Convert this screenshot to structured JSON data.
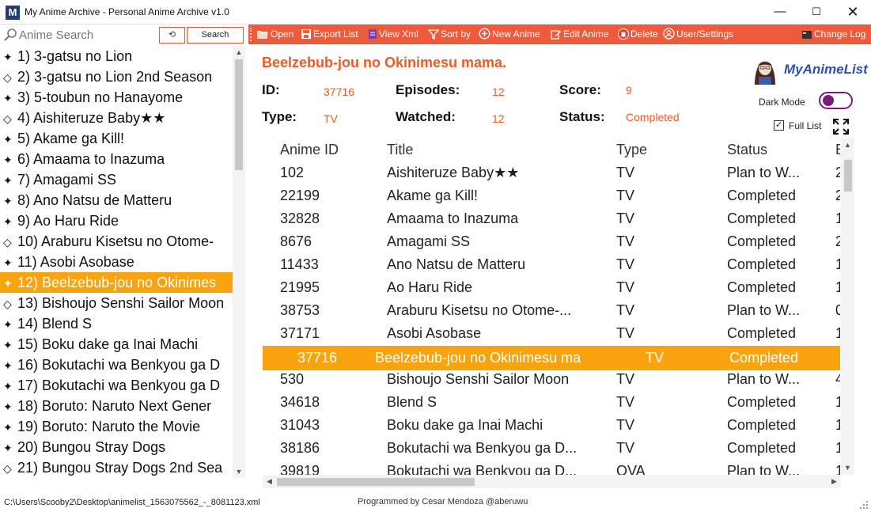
{
  "window": {
    "title": "My Anime Archive - Personal Anime Archive v1.0",
    "app_icon_letter": "M"
  },
  "search": {
    "placeholder": "Anime Search",
    "reset_label": "⟲",
    "button_label": "Search"
  },
  "anime_list": [
    {
      "bullet": "✦",
      "label": "1) 3-gatsu no Lion"
    },
    {
      "bullet": "◇",
      "label": "2) 3-gatsu no Lion 2nd Season"
    },
    {
      "bullet": "✦",
      "label": "3) 5-toubun no Hanayome"
    },
    {
      "bullet": "◇",
      "label": "4) Aishiteruze Baby★★"
    },
    {
      "bullet": "✦",
      "label": "5) Akame ga Kill!"
    },
    {
      "bullet": "✦",
      "label": "6) Amaama to Inazuma"
    },
    {
      "bullet": "✦",
      "label": "7) Amagami SS"
    },
    {
      "bullet": "✦",
      "label": "8) Ano Natsu de Matteru"
    },
    {
      "bullet": "✦",
      "label": "9) Ao Haru Ride"
    },
    {
      "bullet": "◇",
      "label": "10) Araburu Kisetsu no Otome-"
    },
    {
      "bullet": "✦",
      "label": "11) Asobi Asobase"
    },
    {
      "bullet": "✦",
      "label": "12) Beelzebub-jou no Okinimes",
      "selected": true
    },
    {
      "bullet": "◇",
      "label": "13) Bishoujo Senshi Sailor Moon"
    },
    {
      "bullet": "✦",
      "label": "14) Blend S"
    },
    {
      "bullet": "✦",
      "label": "15) Boku dake ga Inai Machi"
    },
    {
      "bullet": "✦",
      "label": "16) Bokutachi wa Benkyou ga D"
    },
    {
      "bullet": "✦",
      "label": "17) Bokutachi wa Benkyou ga D"
    },
    {
      "bullet": "✦",
      "label": "18) Boruto: Naruto Next Gener"
    },
    {
      "bullet": "✦",
      "label": "19) Boruto: Naruto the Movie"
    },
    {
      "bullet": "✦",
      "label": "20) Bungou Stray Dogs"
    },
    {
      "bullet": "◇",
      "label": "21) Bungou Stray Dogs 2nd Sea"
    }
  ],
  "toolbar": {
    "open": "Open",
    "export": "Export List",
    "view_xml": "View Xml",
    "sort_by": "Sort by",
    "new_anime": "New Anime",
    "edit_anime": "Edit Anime",
    "delete": "Delete",
    "user_settings": "User/Settings",
    "change_log": "Change Log"
  },
  "details": {
    "title": "Beelzebub-jou no Okinimesu mama.",
    "id_label": "ID:",
    "id_value": "37716",
    "episodes_label": "Episodes:",
    "episodes_value": "12",
    "score_label": "Score:",
    "score_value": "9",
    "type_label": "Type:",
    "type_value": "TV",
    "watched_label": "Watched:",
    "watched_value": "12",
    "status_label": "Status:",
    "status_value": "Completed"
  },
  "mal": {
    "logo_text": "MyAnimeList"
  },
  "options": {
    "dark_mode_label": "Dark Mode",
    "dark_mode_on": true,
    "full_list_label": "Full List",
    "full_list_checked": true,
    "check_mark": "✓"
  },
  "grid": {
    "columns": [
      "Anime ID",
      "Title",
      "Type",
      "Status",
      "E"
    ],
    "rows": [
      [
        "102",
        "Aishiteruze Baby★★",
        "TV",
        "Plan to W...",
        "2"
      ],
      [
        "22199",
        "Akame ga Kill!",
        "TV",
        "Completed",
        "2"
      ],
      [
        "32828",
        "Amaama to Inazuma",
        "TV",
        "Completed",
        "1"
      ],
      [
        "8676",
        "Amagami SS",
        "TV",
        "Completed",
        "2"
      ],
      [
        "11433",
        "Ano Natsu de Matteru",
        "TV",
        "Completed",
        "1"
      ],
      [
        "21995",
        "Ao Haru Ride",
        "TV",
        "Completed",
        "1"
      ],
      [
        "38753",
        "Araburu Kisetsu no Otome-...",
        "TV",
        "Plan to W...",
        "0"
      ],
      [
        "37171",
        "Asobi Asobase",
        "TV",
        "Completed",
        "1"
      ],
      [
        "37716",
        "Beelzebub-jou no Okinimesu ma",
        "TV",
        "Completed",
        ""
      ],
      [
        "530",
        "Bishoujo Senshi Sailor Moon",
        "TV",
        "Plan to W...",
        "4"
      ],
      [
        "34618",
        "Blend S",
        "TV",
        "Completed",
        "1"
      ],
      [
        "31043",
        "Boku dake ga Inai Machi",
        "TV",
        "Completed",
        "1"
      ],
      [
        "38186",
        "Bokutachi wa Benkyou ga D...",
        "TV",
        "Completed",
        "1"
      ],
      [
        "39819",
        "Bokutachi wa Benkyou ga D...",
        "OVA",
        "Plan to W...",
        "1"
      ]
    ],
    "selected_index": 8
  },
  "status_bar": {
    "path": "C:\\Users\\Scooby2\\Desktop\\animelist_1563075562_-_8081123.xml",
    "credit": "Programmed by Cesar Mendoza @aberuwu"
  },
  "colors": {
    "accent": "#ef5a3b",
    "selection": "#f9a40f",
    "value_text": "#ef5a24",
    "toggle": "#7b1a7b"
  }
}
